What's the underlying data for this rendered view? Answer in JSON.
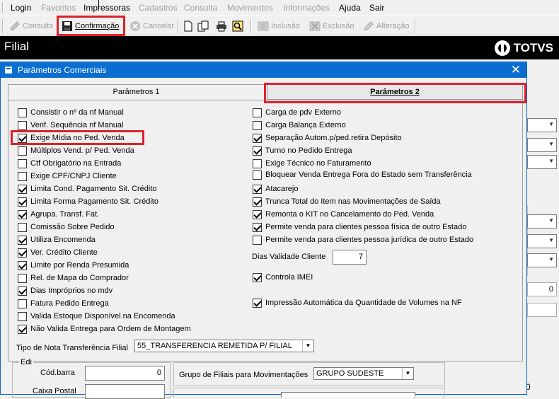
{
  "menu": {
    "items": [
      {
        "label": "Login",
        "enabled": true
      },
      {
        "label": "Favoritos",
        "enabled": false
      },
      {
        "label": "Impressoras",
        "enabled": true
      },
      {
        "label": "Cadastros",
        "enabled": false
      },
      {
        "label": "Consulta",
        "enabled": false
      },
      {
        "label": "Movimentos",
        "enabled": false
      },
      {
        "label": "Informações",
        "enabled": false
      },
      {
        "label": "Ajuda",
        "enabled": true
      },
      {
        "label": "Sair",
        "enabled": true
      }
    ]
  },
  "toolbar": {
    "consulta": "Consulta",
    "confirmacao": "Confirmação",
    "cancelar": "Cancelar",
    "inclusao": "Inclusão",
    "exclusao": "Exclusão",
    "alteracao": "Alteração"
  },
  "header": {
    "title": "Filial",
    "brand": "TOTVS"
  },
  "dialog": {
    "title": "Parâmetros Comerciais",
    "tabs": [
      "Parâmetros 1",
      "Parâmetros 2"
    ],
    "left_checks": [
      {
        "label": "Consistir o nº da nf Manual",
        "checked": false
      },
      {
        "label": "Verif. Sequência nf Manual",
        "checked": false
      },
      {
        "label": "Exige Mídia no Ped. Venda",
        "checked": true
      },
      {
        "label": "Múltiplos Vend. p/ Ped. Venda",
        "checked": false
      },
      {
        "label": "Ctf Obrigatório na Entrada",
        "checked": false
      },
      {
        "label": "Exige CPF/CNPJ Cliente",
        "checked": false
      },
      {
        "label": "Limita Cond. Pagamento Sit. Crédito",
        "checked": true
      },
      {
        "label": "Limita Forma Pagamento Sit. Crédito",
        "checked": true
      },
      {
        "label": "Agrupa. Transf. Fat.",
        "checked": true
      },
      {
        "label": "Comissão Sobre Pedido",
        "checked": false
      },
      {
        "label": "Utiliza Encomenda",
        "checked": true
      },
      {
        "label": "Ver. Crédito Cliente",
        "checked": true
      },
      {
        "label": "Limite por Renda Presumida",
        "checked": true
      },
      {
        "label": "Rel. de Mapa do Comprador",
        "checked": false
      },
      {
        "label": "Dias Impróprios no mdv",
        "checked": true
      },
      {
        "label": "Fatura Pedido Entrega",
        "checked": false
      },
      {
        "label": "Valida Estoque Disponível na Encomenda",
        "checked": false
      },
      {
        "label": "Não Valida Entrega para Ordem de Montagem",
        "checked": true
      }
    ],
    "right_checks": [
      {
        "label": "Carga de pdv Externo",
        "checked": false
      },
      {
        "label": "Carga Balança Externo",
        "checked": false
      },
      {
        "label": "Separação Autom.p/ped.retira Depósito",
        "checked": true
      },
      {
        "label": "Turno no Pedido Entrega",
        "checked": true
      },
      {
        "label": "Exige Técnico no Faturamento",
        "checked": false
      },
      {
        "label": "Bloquear Venda Entrega Fora do Estado sem Transferência",
        "checked": false
      },
      {
        "label": "Atacarejo",
        "checked": true
      },
      {
        "label": "Trunca Total do Item nas Movimentações de Saída",
        "checked": true
      },
      {
        "label": "Remonta o KIT no Cancelamento do Ped. Venda",
        "checked": true
      },
      {
        "label": "Permite venda para clientes pessoa física de outro Estado",
        "checked": true
      },
      {
        "label": "Permite venda para clientes pessoa jurídica de outro Estado",
        "checked": false
      }
    ],
    "dias_validade_label": "Dias Validade Cliente",
    "dias_validade_value": "7",
    "controla_imei": {
      "label": "Controla IMEI",
      "checked": true
    },
    "impressao_auto": {
      "label": "Impressão Automática da Quantidade de Volumes na NF",
      "checked": true
    },
    "tipo_nota_label": "Tipo de Nota Transferência Filial",
    "tipo_nota_value": "55_TRANSFERENCIA REMETIDA P/ FILIAL",
    "edi_label": "Edi",
    "cod_barra_label": "Cód.barra",
    "cod_barra_value": "0",
    "caixa_postal_label": "Caixa Postal",
    "grupo_filiais_label": "Grupo de Filiais para Movimentações",
    "grupo_filiais_value": "GRUPO SUDESTE"
  },
  "background": {
    "field_value_1": "0",
    "field_value_2": "0"
  }
}
